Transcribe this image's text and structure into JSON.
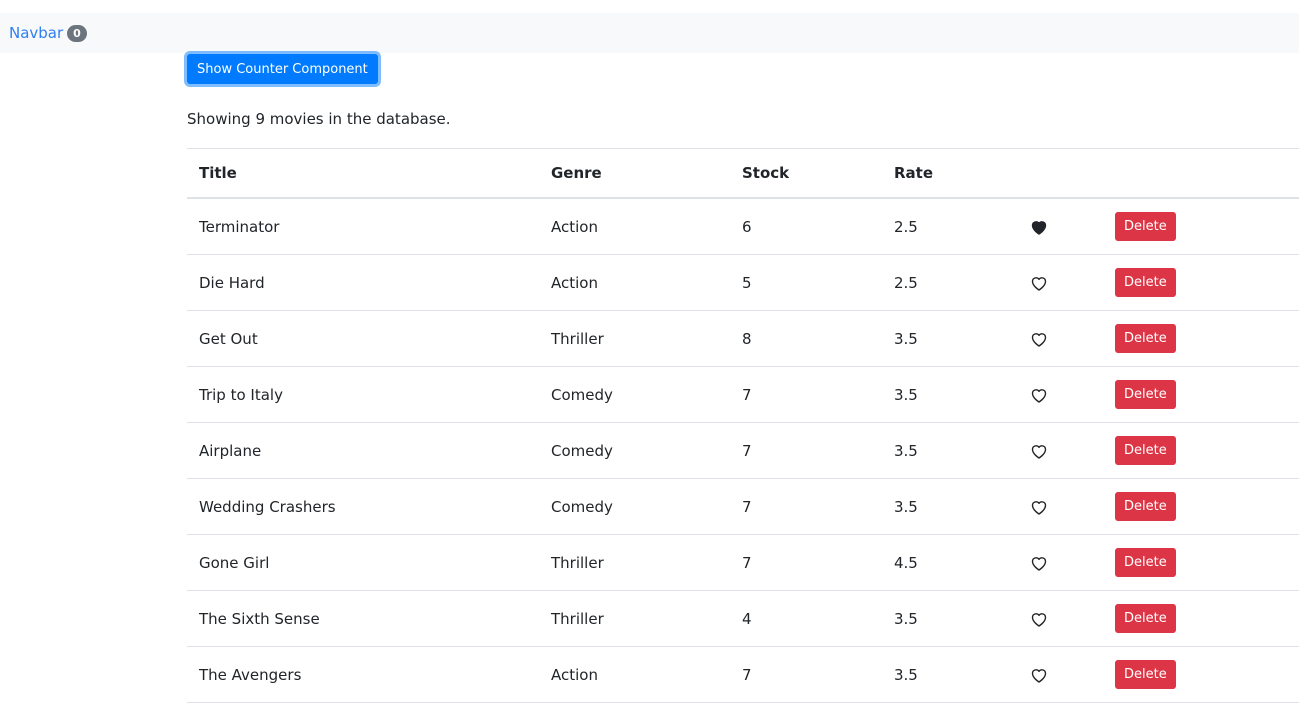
{
  "navbar": {
    "brand": "Navbar",
    "count": "0"
  },
  "show_counter_button": "Show Counter Component",
  "summary": "Showing 9 movies in the database.",
  "table": {
    "headers": [
      "Title",
      "Genre",
      "Stock",
      "Rate"
    ],
    "delete_label": "Delete",
    "rows": [
      {
        "title": "Terminator",
        "genre": "Action",
        "stock": "6",
        "rate": "2.5",
        "liked": true
      },
      {
        "title": "Die Hard",
        "genre": "Action",
        "stock": "5",
        "rate": "2.5",
        "liked": false
      },
      {
        "title": "Get Out",
        "genre": "Thriller",
        "stock": "8",
        "rate": "3.5",
        "liked": false
      },
      {
        "title": "Trip to Italy",
        "genre": "Comedy",
        "stock": "7",
        "rate": "3.5",
        "liked": false
      },
      {
        "title": "Airplane",
        "genre": "Comedy",
        "stock": "7",
        "rate": "3.5",
        "liked": false
      },
      {
        "title": "Wedding Crashers",
        "genre": "Comedy",
        "stock": "7",
        "rate": "3.5",
        "liked": false
      },
      {
        "title": "Gone Girl",
        "genre": "Thriller",
        "stock": "7",
        "rate": "4.5",
        "liked": false
      },
      {
        "title": "The Sixth Sense",
        "genre": "Thriller",
        "stock": "4",
        "rate": "3.5",
        "liked": false
      },
      {
        "title": "The Avengers",
        "genre": "Action",
        "stock": "7",
        "rate": "3.5",
        "liked": false
      }
    ]
  },
  "colors": {
    "primary": "#007bff",
    "danger": "#dc3545",
    "link": "#2f7ff0"
  }
}
